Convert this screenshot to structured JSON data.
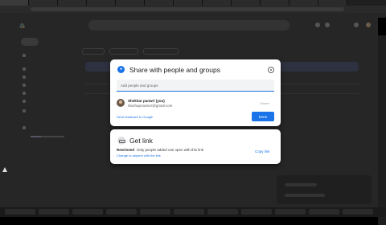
{
  "browser": {
    "tabs": [
      "",
      "",
      "",
      "",
      "",
      "",
      "",
      "",
      "",
      "",
      "",
      ""
    ]
  },
  "share_dialog": {
    "title": "Share with people and groups",
    "add_placeholder": "Add people and groups",
    "person": {
      "name": "Shekhar panwri (you)",
      "email": "Moshaproamer@gmail.com",
      "role": "Owner"
    },
    "feedback_link": "Send feedback to Google",
    "done_label": "Done"
  },
  "link_dialog": {
    "title": "Get link",
    "restricted_label": "Restricted",
    "restricted_desc": "Only people added can open with this link",
    "change_link": "Change to anyone with the link",
    "copy_link": "Copy link"
  },
  "colors": {
    "accent": "#1a73e8",
    "overlay": "#262626"
  }
}
